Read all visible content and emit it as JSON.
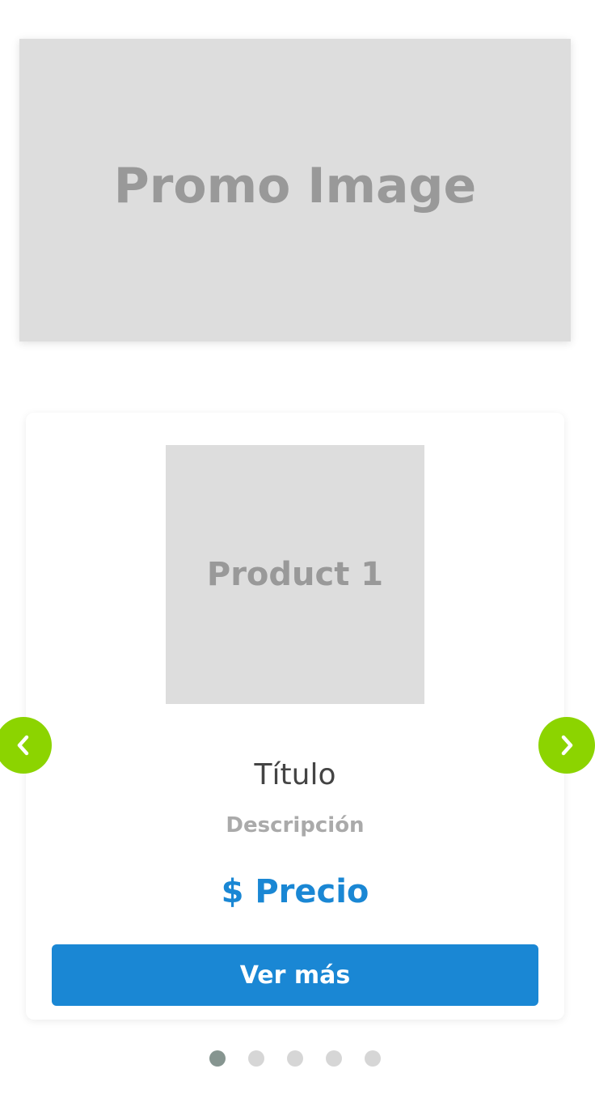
{
  "promo": {
    "label": "Promo Image"
  },
  "product_card": {
    "image_label": "Product 1",
    "title": "Título",
    "description": "Descripción",
    "price": "$ Precio",
    "button_label": "Ver más"
  },
  "carousel": {
    "prev_icon": "chevron-left-icon",
    "next_icon": "chevron-right-icon",
    "dots_count": 5,
    "active_index": 0
  },
  "colors": {
    "accent_blue": "#1a87d4",
    "nav_green": "#8cd400",
    "placeholder_gray": "#dddddd",
    "dot_active": "#869590",
    "dot_inactive": "#d6d6d6"
  }
}
